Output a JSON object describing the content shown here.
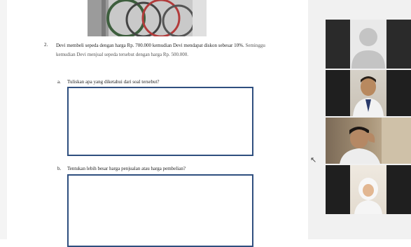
{
  "document": {
    "question_number": "2.",
    "question_text_main": "Devi membeli sepeda dengan harga Rp. 700.000 kemudian Devi mendapat diskon sebesar 10%.",
    "question_text_rest": "Seminggu kemudian Devi menjual sepeda tersebut dengan harga Rp. 500.000.",
    "sub_a_label": "a.",
    "sub_a_text": "Tuliskan apa yang diketahui dari soal tersebut?",
    "sub_b_label": "b.",
    "sub_b_text": "Tentukan lebih besar harga penjualan atau harga pembelian?"
  },
  "participants": [
    {
      "type": "avatar-placeholder",
      "icon": "user-silhouette-icon"
    },
    {
      "type": "video",
      "description_color": "#c9a27a"
    },
    {
      "type": "video",
      "description_color": "#8a7a6a"
    },
    {
      "type": "video",
      "description_color": "#e9e1d6"
    }
  ],
  "colors": {
    "box_border": "#2f4f7f",
    "sidebar_bg": "#f1f1f1",
    "tile_bg": "#1f1f1f"
  }
}
